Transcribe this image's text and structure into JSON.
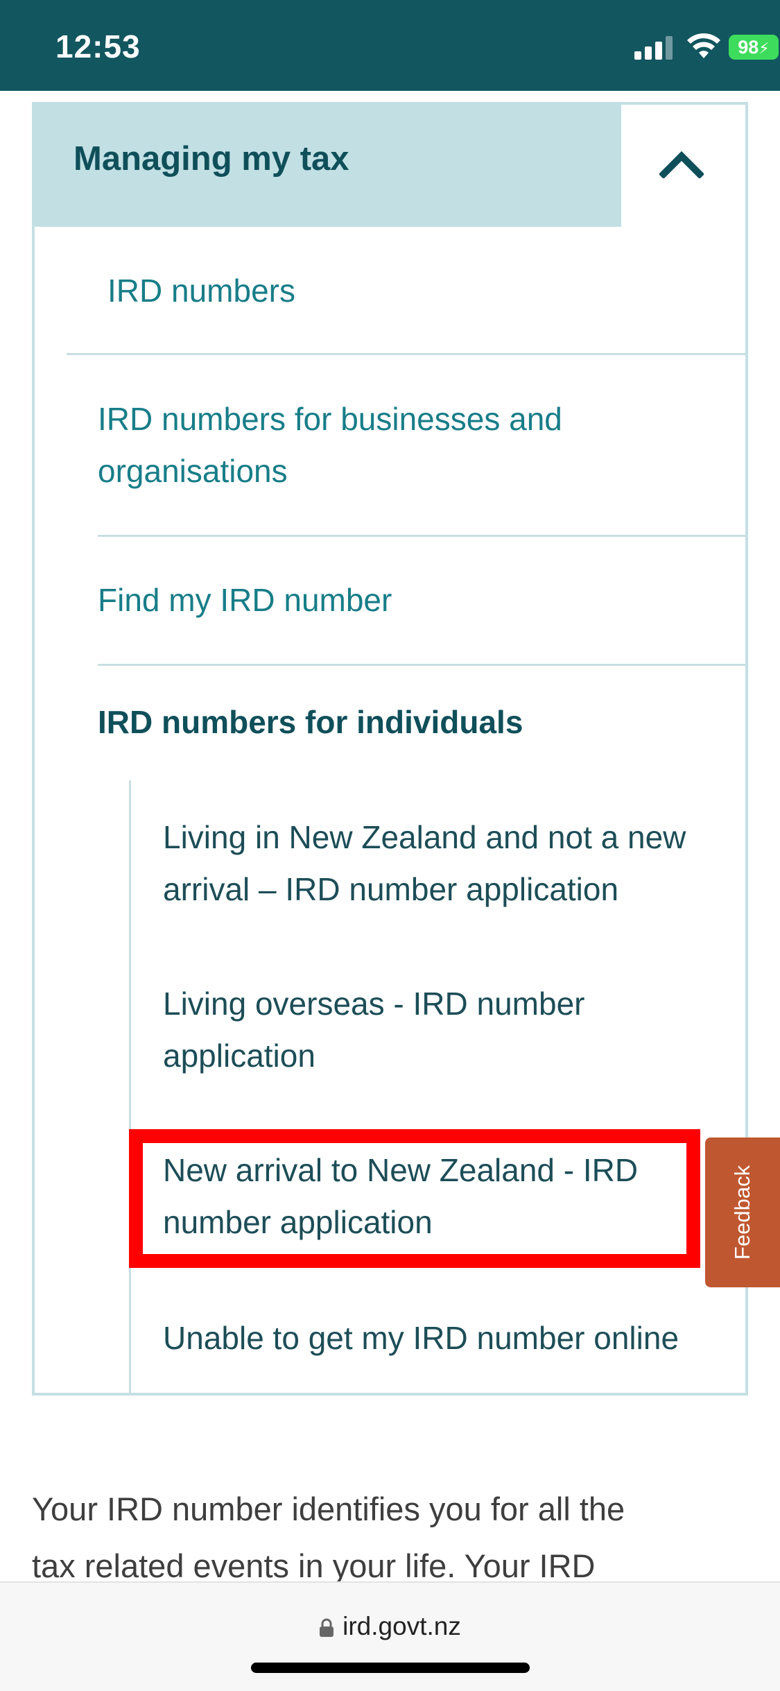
{
  "status_bar": {
    "time": "12:53",
    "battery": "98",
    "icons": [
      "signal-icon",
      "wifi-icon",
      "battery-charging-icon"
    ],
    "background": "#12565f"
  },
  "menu": {
    "title": "Managing my tax",
    "toggle_icon": "chevron-up-icon",
    "items": [
      {
        "label": "IRD numbers"
      },
      {
        "label_line1": "IRD numbers for businesses and",
        "label_line2": "organisations"
      },
      {
        "label": "Find my IRD number"
      }
    ],
    "current_section": "IRD numbers for individuals",
    "sub_items": [
      {
        "label_line1": "Living in New Zealand and not a new",
        "label_line2": "arrival – IRD number application"
      },
      {
        "label_line1": "Living overseas - IRD number",
        "label_line2": "application"
      },
      {
        "label_line1": "New arrival to New Zealand - IRD",
        "label_line2": "number application",
        "highlighted": true
      },
      {
        "label": "Unable to get my IRD number online"
      }
    ],
    "colors": {
      "header_bg": "#c2e0e4",
      "link": "#177d88",
      "highlight": "#ff0000"
    }
  },
  "feedback_tab": {
    "label": "Feedback",
    "color": "#bf5730"
  },
  "body": {
    "line1": "Your IRD number identifies you for all the",
    "line2": "tax related events in your life. Your IRD"
  },
  "browser": {
    "url": "ird.govt.nz",
    "lock_icon": "lock-icon"
  }
}
